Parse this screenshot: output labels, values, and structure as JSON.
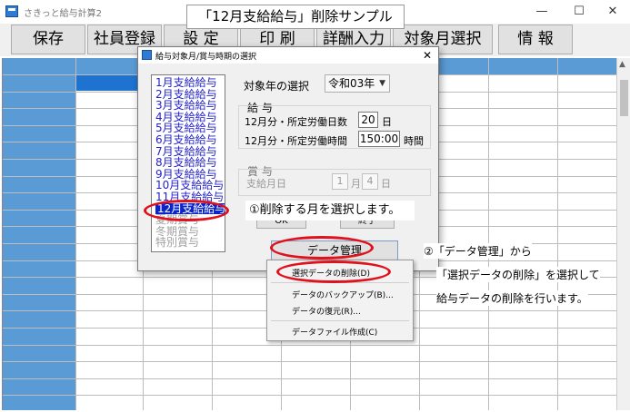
{
  "window": {
    "title": "さきっと給与計算2",
    "min_glyph": "—",
    "max_glyph": "☐",
    "close_glyph": "✕"
  },
  "caption": "「12月支給給与」削除サンプル",
  "toolbar": {
    "save": "保存",
    "employee": "社員登録",
    "settings": "設 定",
    "print": "印 刷",
    "remuneration": "詳酬入力",
    "target_month": "対象月選択",
    "info": "情 報"
  },
  "dialog": {
    "title": "給与対象月/賞与時期の選択",
    "close_glyph": "✕",
    "months": [
      {
        "label": "1月支給給与",
        "state": "normal"
      },
      {
        "label": "2月支給給与",
        "state": "normal"
      },
      {
        "label": "3月支給給与",
        "state": "normal"
      },
      {
        "label": "4月支給給与",
        "state": "normal"
      },
      {
        "label": "5月支給給与",
        "state": "normal"
      },
      {
        "label": "6月支給給与",
        "state": "normal"
      },
      {
        "label": "7月支給給与",
        "state": "normal"
      },
      {
        "label": "8月支給給与",
        "state": "normal"
      },
      {
        "label": "9月支給給与",
        "state": "normal"
      },
      {
        "label": "10月支給給与",
        "state": "normal"
      },
      {
        "label": "11月支給給与",
        "state": "normal"
      },
      {
        "label": "12月支給給与",
        "state": "selected"
      },
      {
        "label": "夏期賞与",
        "state": "disabled"
      },
      {
        "label": "冬期賞与",
        "state": "disabled"
      },
      {
        "label": "特別賞与",
        "state": "disabled"
      }
    ],
    "year_label": "対象年の選択",
    "year_value": "令和03年",
    "salary_heading": "給 与",
    "workdays_label": "12月分・所定労働日数",
    "workdays_value": "20",
    "workdays_unit": "日",
    "workhours_label": "12月分・所定労働時間",
    "workhours_value": "150:00",
    "workhours_unit": "時間",
    "bonus_heading": "賞 与",
    "bonus_date_label": "支給月日",
    "bonus_month_value": "1",
    "bonus_month_unit": "月",
    "bonus_day_value": "4",
    "bonus_day_unit": "日",
    "ok_label": "OK",
    "close_label": "終了",
    "data_mgmt_label": "データ管理"
  },
  "context_menu": {
    "items": [
      "選択データの削除(D)",
      "データのバックアップ(B)...",
      "データの復元(R)...",
      "データファイル作成(C)"
    ]
  },
  "notes": {
    "step1": "①削除する月を選択します。",
    "step2_line1": "②「データ管理」から",
    "step2_line2": "「選択データの削除」を選択して",
    "step2_line3": "給与データの削除を行います。"
  },
  "colors": {
    "grid_header": "#5b9bd5",
    "selected_cell": "#1e73d0",
    "annotation_red": "#e0101c",
    "month_text": "#2222cc"
  }
}
